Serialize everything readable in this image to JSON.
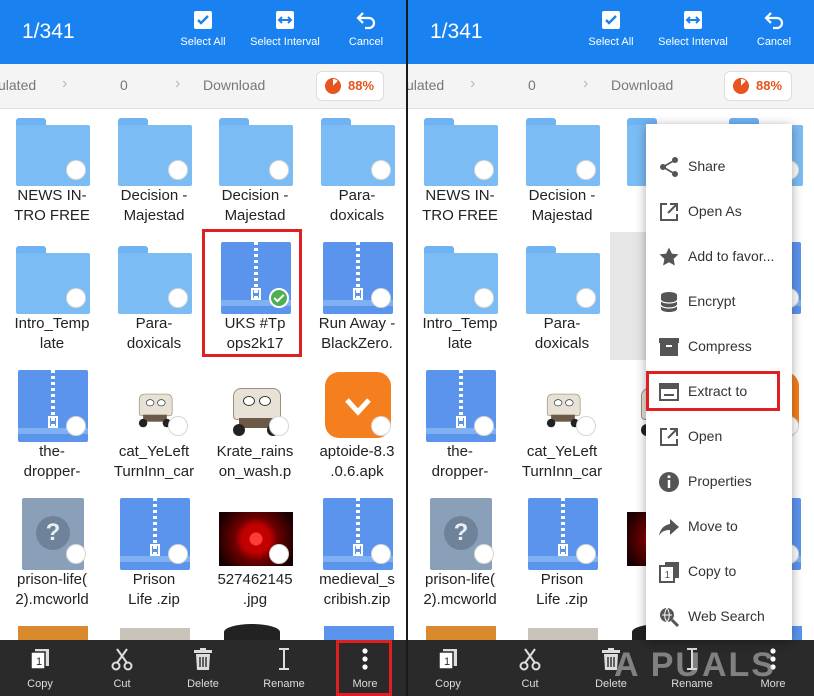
{
  "header": {
    "counter": "1/341",
    "actions": [
      {
        "label": "Select All",
        "icon": "checkbox-icon"
      },
      {
        "label": "Select Interval",
        "icon": "interval-icon"
      },
      {
        "label": "Cancel",
        "icon": "undo-icon"
      }
    ]
  },
  "path": {
    "crumbs": [
      "ulated",
      "0",
      "Download"
    ],
    "storage_percent": "88%"
  },
  "files": [
    {
      "name": "NEWS IN-\nTRO FREE",
      "type": "folder"
    },
    {
      "name": "Decision -\nMajestad",
      "type": "folder"
    },
    {
      "name": "Decision -\nMajestad",
      "type": "folder"
    },
    {
      "name": "Para-\ndoxicals",
      "type": "folder"
    },
    {
      "name": "Intro_Temp\nlate",
      "type": "folder"
    },
    {
      "name": "Para-\ndoxicals",
      "type": "folder"
    },
    {
      "name": "UKS #Tp\nops2k17",
      "type": "zip",
      "selected": true
    },
    {
      "name": "Run Away -\nBlackZero.",
      "type": "zip"
    },
    {
      "name": "the-\ndropper-",
      "type": "zip"
    },
    {
      "name": "cat_YeLeft\nTurnInn_car",
      "type": "image-truck-small"
    },
    {
      "name": "Krate_rains\non_wash.p",
      "type": "image-truck"
    },
    {
      "name": "aptoide-8.3\n.0.6.apk",
      "type": "apk"
    },
    {
      "name": "prison-life(\n2).mcworld",
      "type": "unknown"
    },
    {
      "name": "Prison\nLife .zip",
      "type": "zip"
    },
    {
      "name": "527462145\n.jpg",
      "type": "jpg"
    },
    {
      "name": "medieval_s\ncribish.zip",
      "type": "zip"
    }
  ],
  "right_files": [
    {
      "name": "NEWS IN-\nTRO FREE"
    },
    {
      "name": "Decision -\nMajestad"
    },
    {
      "name": "De\nMa"
    },
    {
      "name": ""
    },
    {
      "name": "Intro_Temp\nlate"
    },
    {
      "name": "Para-\ndoxicals"
    },
    {
      "name": "UK\nop"
    },
    {
      "name": "y -\no."
    },
    {
      "name": "the-\ndropper-"
    },
    {
      "name": "cat_YeLeft\nTurnInn_car"
    },
    {
      "name": "Kra\non_"
    },
    {
      "name": ".3"
    },
    {
      "name": "prison-life(\n2).mcworld"
    },
    {
      "name": "Prison\nLife .zip"
    },
    {
      "name": "527"
    },
    {
      "name": "_s\np"
    }
  ],
  "bottom": {
    "actions": [
      {
        "label": "Copy"
      },
      {
        "label": "Cut"
      },
      {
        "label": "Delete"
      },
      {
        "label": "Rename"
      },
      {
        "label": "More"
      }
    ]
  },
  "menu": {
    "items": [
      {
        "label": "Share",
        "icon": "share-icon"
      },
      {
        "label": "Open As",
        "icon": "open-external-icon"
      },
      {
        "label": "Add to favor...",
        "icon": "star-icon"
      },
      {
        "label": "Encrypt",
        "icon": "database-icon"
      },
      {
        "label": "Compress",
        "icon": "archive-icon"
      },
      {
        "label": "Extract to",
        "icon": "extract-icon",
        "highlighted": true
      },
      {
        "label": "Open",
        "icon": "open-external-icon"
      },
      {
        "label": "Properties",
        "icon": "info-icon"
      },
      {
        "label": "Move to",
        "icon": "forward-icon"
      },
      {
        "label": "Copy to",
        "icon": "copy-icon"
      },
      {
        "label": "Web Search",
        "icon": "web-search-icon"
      }
    ]
  },
  "watermark": "A PUALS",
  "colors": {
    "accent": "#1a82f0",
    "highlight": "#e02020",
    "storage": "#e8531e",
    "bottom_bar": "#2a2a2a"
  }
}
